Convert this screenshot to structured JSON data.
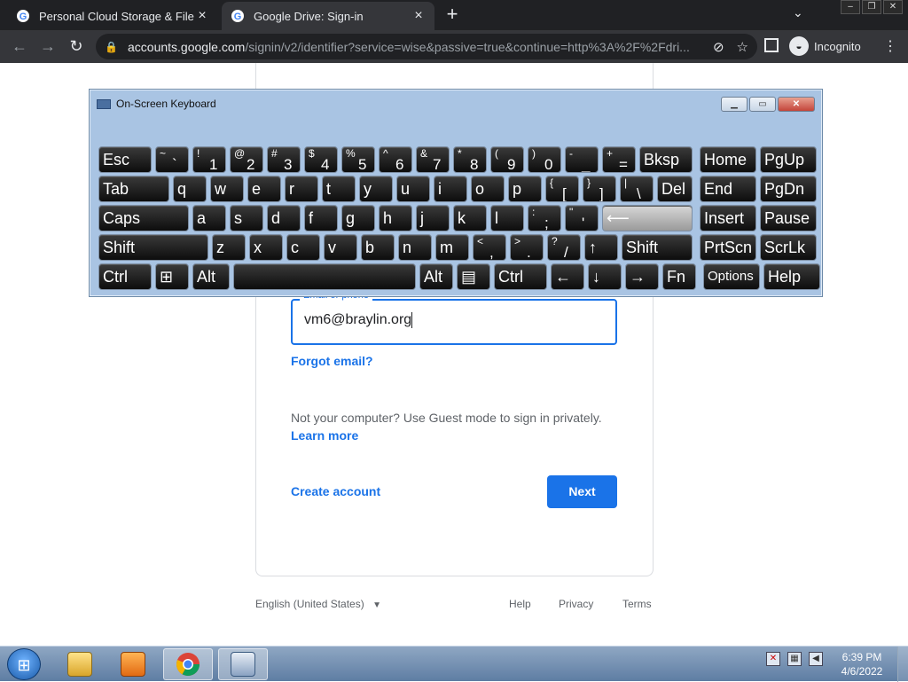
{
  "browser": {
    "tabs": [
      {
        "title": "Personal Cloud Storage & File Sh",
        "active": false
      },
      {
        "title": "Google Drive: Sign-in",
        "active": true
      }
    ],
    "new_tab": "+",
    "url_host": "accounts.google.com",
    "url_path": "/signin/v2/identifier?service=wise&passive=true&continue=http%3A%2F%2Fdri...",
    "profile_label": "Incognito"
  },
  "signin": {
    "email_label": "Email or phone",
    "email_value": "vm6@braylin.org",
    "forgot_email": "Forgot email?",
    "guest_text": "Not your computer? Use Guest mode to sign in privately.",
    "learn_more": "Learn more",
    "create_account": "Create account",
    "next": "Next",
    "language": "English (United States)",
    "help": "Help",
    "privacy": "Privacy",
    "terms": "Terms"
  },
  "keyboard": {
    "title": "On-Screen Keyboard",
    "rows": [
      [
        {
          "m": "Esc"
        },
        {
          "s": "~",
          "p": "`"
        },
        {
          "s": "!",
          "p": "1"
        },
        {
          "s": "@",
          "p": "2"
        },
        {
          "s": "#",
          "p": "3"
        },
        {
          "s": "$",
          "p": "4"
        },
        {
          "s": "%",
          "p": "5"
        },
        {
          "s": "^",
          "p": "6"
        },
        {
          "s": "&",
          "p": "7"
        },
        {
          "s": "*",
          "p": "8"
        },
        {
          "s": "(",
          "p": "9"
        },
        {
          "s": ")",
          "p": "0"
        },
        {
          "s": "-",
          "p": "_"
        },
        {
          "s": "+",
          "p": "="
        },
        {
          "m": "Bksp"
        },
        {
          "m": "Home"
        },
        {
          "m": "PgUp"
        }
      ],
      [
        {
          "m": "Tab"
        },
        {
          "m": "q"
        },
        {
          "m": "w"
        },
        {
          "m": "e"
        },
        {
          "m": "r"
        },
        {
          "m": "t"
        },
        {
          "m": "y"
        },
        {
          "m": "u"
        },
        {
          "m": "i"
        },
        {
          "m": "o"
        },
        {
          "m": "p"
        },
        {
          "s": "{",
          "p": "["
        },
        {
          "s": "}",
          "p": "]"
        },
        {
          "s": "|",
          "p": "\\"
        },
        {
          "m": "Del"
        },
        {
          "m": "End"
        },
        {
          "m": "PgDn"
        }
      ],
      [
        {
          "m": "Caps"
        },
        {
          "m": "a"
        },
        {
          "m": "s"
        },
        {
          "m": "d"
        },
        {
          "m": "f"
        },
        {
          "m": "g"
        },
        {
          "m": "h"
        },
        {
          "m": "j"
        },
        {
          "m": "k"
        },
        {
          "m": "l"
        },
        {
          "s": ":",
          "p": ";"
        },
        {
          "s": "\"",
          "p": "'"
        },
        {
          "m": "⟵"
        },
        {
          "m": "Insert"
        },
        {
          "m": "Pause"
        }
      ],
      [
        {
          "m": "Shift"
        },
        {
          "m": "z"
        },
        {
          "m": "x"
        },
        {
          "m": "c"
        },
        {
          "m": "v"
        },
        {
          "m": "b"
        },
        {
          "m": "n"
        },
        {
          "m": "m"
        },
        {
          "s": "<",
          "p": ","
        },
        {
          "s": ">",
          "p": "."
        },
        {
          "s": "?",
          "p": "/"
        },
        {
          "m": "↑"
        },
        {
          "m": "Shift"
        },
        {
          "m": "PrtScn"
        },
        {
          "m": "ScrLk"
        }
      ],
      [
        {
          "m": "Ctrl"
        },
        {
          "m": "⊞"
        },
        {
          "m": "Alt"
        },
        {
          "m": ""
        },
        {
          "m": "Alt"
        },
        {
          "m": "▤"
        },
        {
          "m": "Ctrl"
        },
        {
          "m": "←"
        },
        {
          "m": "↓"
        },
        {
          "m": "→"
        },
        {
          "m": "Fn"
        },
        {
          "m": "Options"
        },
        {
          "m": "Help"
        }
      ]
    ]
  },
  "taskbar": {
    "time": "6:39 PM",
    "date": "4/6/2022"
  }
}
